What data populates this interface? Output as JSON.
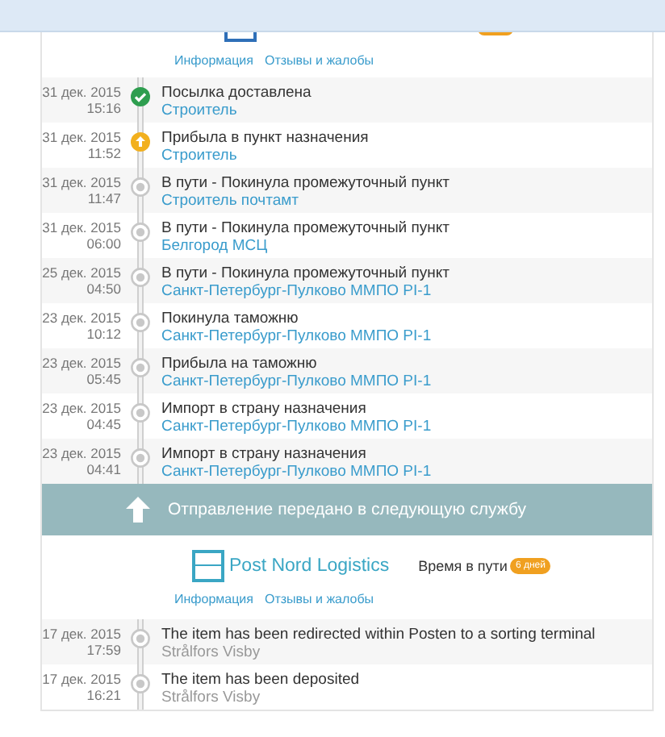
{
  "first_service": {
    "links": [
      "Информация",
      "Отзывы и жалобы"
    ],
    "events": [
      {
        "date": "31 дек. 2015",
        "time": "15:16",
        "status": "Посылка доставлена",
        "location": "Строитель",
        "kind": "delivered",
        "link": true
      },
      {
        "date": "31 дек. 2015",
        "time": "11:52",
        "status": "Прибыла в пункт назначения",
        "location": "Строитель",
        "kind": "arrived",
        "link": true
      },
      {
        "date": "31 дек. 2015",
        "time": "11:47",
        "status": "В пути - Покинула промежуточный пункт",
        "location": "Строитель почтамт",
        "kind": "transit",
        "link": true
      },
      {
        "date": "31 дек. 2015",
        "time": "06:00",
        "status": "В пути - Покинула промежуточный пункт",
        "location": "Белгород МСЦ",
        "kind": "transit",
        "link": true
      },
      {
        "date": "25 дек. 2015",
        "time": "04:50",
        "status": "В пути - Покинула промежуточный пункт",
        "location": "Санкт-Петербург-Пулково ММПО PI-1",
        "kind": "transit",
        "link": true
      },
      {
        "date": "23 дек. 2015",
        "time": "10:12",
        "status": "Покинула таможню",
        "location": "Санкт-Петербург-Пулково ММПО PI-1",
        "kind": "transit",
        "link": true
      },
      {
        "date": "23 дек. 2015",
        "time": "05:45",
        "status": "Прибыла на таможню",
        "location": "Санкт-Петербург-Пулково ММПО PI-1",
        "kind": "transit",
        "link": true
      },
      {
        "date": "23 дек. 2015",
        "time": "04:45",
        "status": "Импорт в страну назначения",
        "location": "Санкт-Петербург-Пулково ММПО PI-1",
        "kind": "transit",
        "link": true
      },
      {
        "date": "23 дек. 2015",
        "time": "04:41",
        "status": "Импорт в страну назначения",
        "location": "Санкт-Петербург-Пулково ММПО PI-1",
        "kind": "transit",
        "link": true
      }
    ]
  },
  "handover": {
    "text": "Отправление передано в следующую службу"
  },
  "second_service": {
    "name": "Post Nord Logistics",
    "transit_label": "Время в пути",
    "transit_badge": "6 дней",
    "links": [
      "Информация",
      "Отзывы и жалобы"
    ],
    "events": [
      {
        "date": "17 дек. 2015",
        "time": "17:59",
        "status": "The item has been redirected within Posten to a sorting terminal",
        "location": "Strålfors Visby",
        "kind": "transit",
        "link": false
      },
      {
        "date": "17 дек. 2015",
        "time": "16:21",
        "status": "The item has been deposited",
        "location": "Strålfors Visby",
        "kind": "transit",
        "link": false
      }
    ]
  }
}
